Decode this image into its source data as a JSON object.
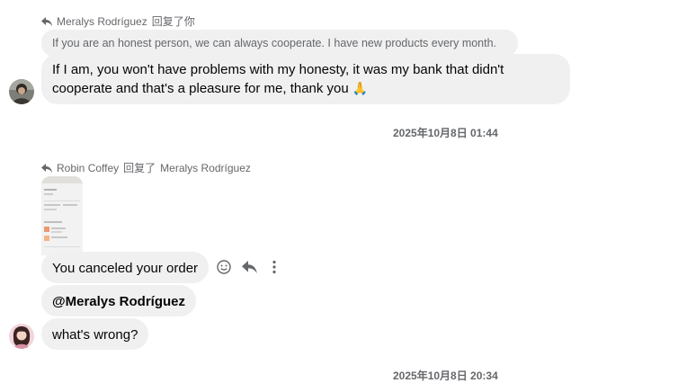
{
  "thread": {
    "group1": {
      "reply_author": "Meralys Rodríguez",
      "reply_action": "回复了你",
      "quoted_text": "If you are an honest person, we can always cooperate. I have new products every month.",
      "message_text": "If I am, you won't have problems with my honesty, it was my bank that didn't cooperate and that's a pleasure for me, thank you",
      "emoji": "🙏"
    },
    "timestamp1": "2025年10月8日 01:44",
    "group2": {
      "reply_author": "Robin Coffey",
      "reply_action": "回复了",
      "reply_target": "Meralys Rodríguez",
      "messages": [
        "You canceled your order",
        "@Meralys Rodríguez",
        "what's wrong?"
      ]
    },
    "timestamp2": "2025年10月8日 20:34"
  },
  "icons": {
    "reply": "reply-arrow-icon",
    "react": "smiley-icon",
    "more": "more-vertical-icon"
  },
  "colors": {
    "bubble": "#f0f0f0",
    "secondary_text": "#65676b",
    "primary_text": "#050505"
  }
}
